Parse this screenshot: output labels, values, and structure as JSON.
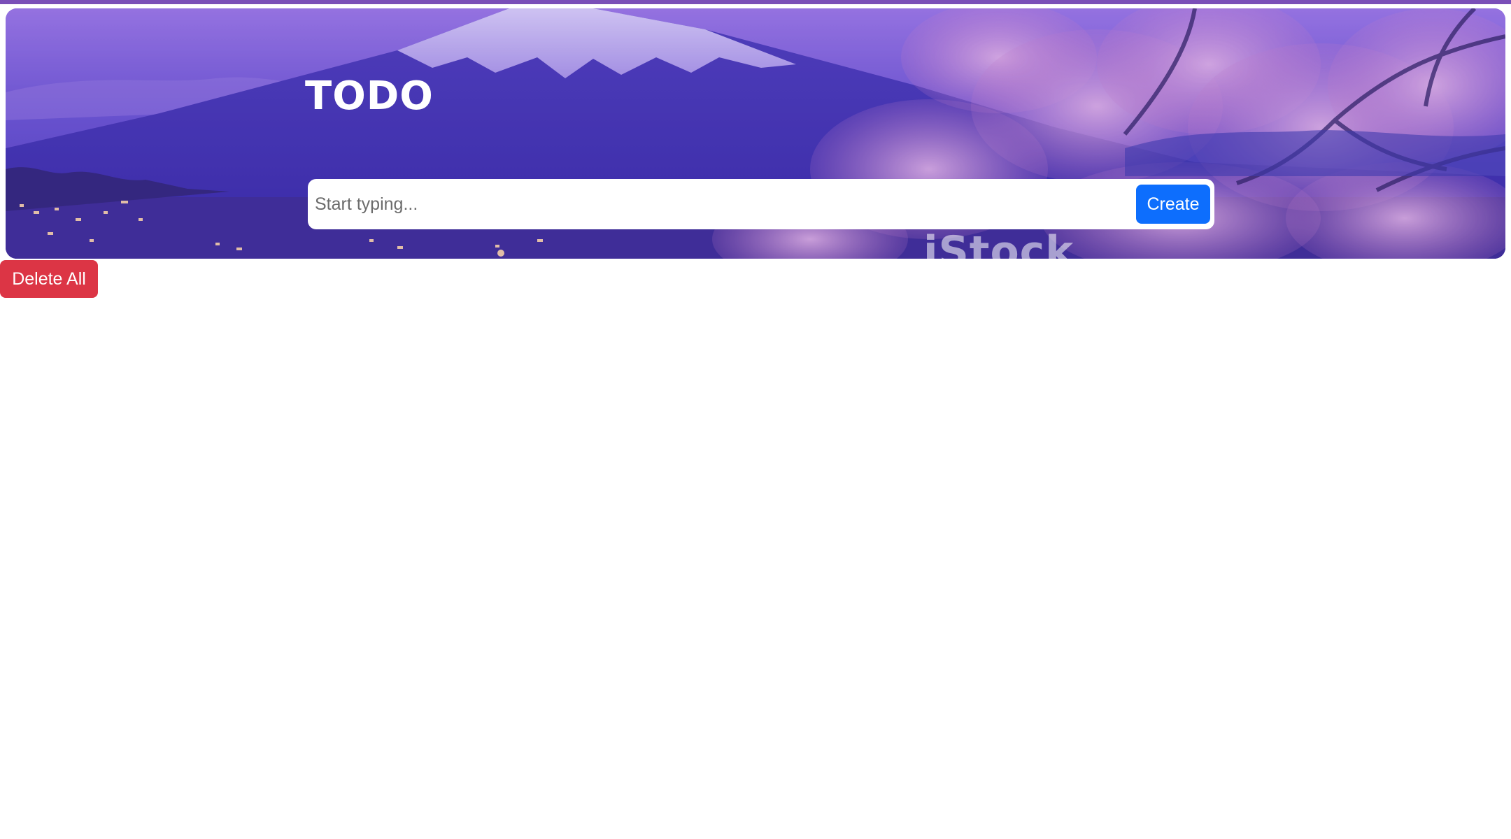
{
  "header": {
    "title": "TODO",
    "watermark": "iStock"
  },
  "new_task": {
    "placeholder": "Start typing...",
    "value": "",
    "create_label": "Create"
  },
  "actions": {
    "delete_all_label": "Delete All"
  },
  "colors": {
    "accent_bar": "#7a4fb8",
    "primary": "#0d6efd",
    "danger": "#dc3545",
    "hero_tint": "#5a43c4"
  },
  "background_image": "Mount Fuji with cherry blossoms at dusk, purple tint"
}
